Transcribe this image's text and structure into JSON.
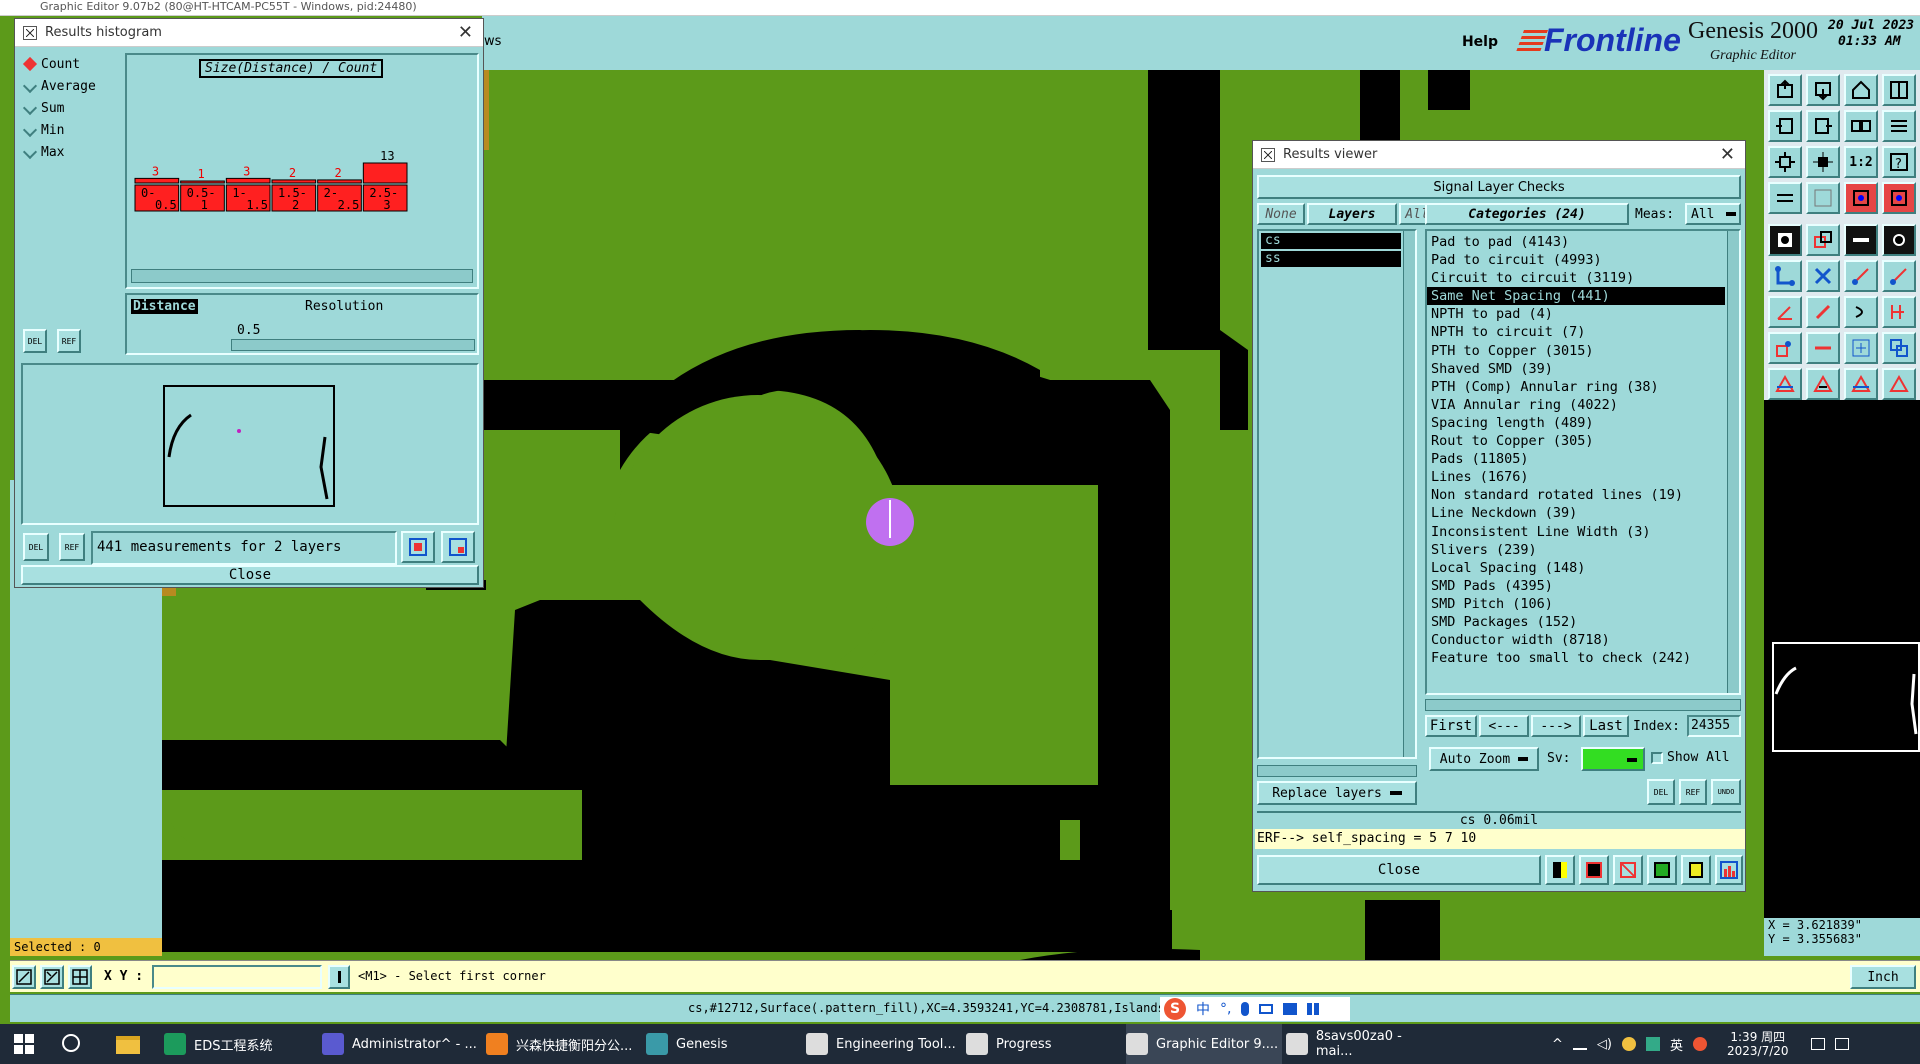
{
  "app": {
    "title": "Graphic Editor 9.07b2 (80@HT-HTCAM-PC55T - Windows, pid:24480)",
    "menu_help": "Help",
    "menu_partial": "ws",
    "logo_frontline": "Frontline",
    "logo_product": "Genesis 2000",
    "logo_subtitle": "Graphic Editor",
    "date": "20 Jul 2023",
    "time": "01:33 AM"
  },
  "histogram": {
    "window_title": "Results histogram",
    "options": [
      "Count",
      "Average",
      "Sum",
      "Min",
      "Max"
    ],
    "selected_option": "Count",
    "chart_title": "Size(Distance) / Count",
    "distance_label": "Distance",
    "resolution_label": "Resolution",
    "resolution_value": "0.5",
    "measurements_text": "441 measurements for 2 layers",
    "close_label": "Close",
    "del_label": "DEL",
    "ref_label": "REF"
  },
  "chart_data": {
    "type": "bar",
    "categories": [
      "0-0.5",
      "0.5-1",
      "1-1.5",
      "1.5-2",
      "2-2.5",
      "2.5-3"
    ],
    "category_labels": [
      [
        "0-",
        "0.5"
      ],
      [
        "0.5-",
        "1"
      ],
      [
        "1-",
        "1.5"
      ],
      [
        "1.5-",
        "2"
      ],
      [
        "2-",
        "2.5"
      ],
      [
        "2.5-",
        "3"
      ]
    ],
    "values": [
      3,
      1,
      3,
      2,
      2,
      13
    ],
    "title": "Size(Distance) / Count",
    "xlabel": "Distance",
    "ylabel": "",
    "ylim": [
      0,
      13
    ],
    "bar_color": "#ff2020",
    "grid": false
  },
  "results_viewer": {
    "window_title": "Results viewer",
    "header": "Signal Layer Checks",
    "none_label": "None",
    "layers_label": "Layers",
    "all_label": "All",
    "layers": [
      "cs",
      "ss"
    ],
    "categories_label": "Categories (24)",
    "meas_label": "Meas:",
    "meas_value": "All",
    "categories": [
      "Pad to pad (4143)",
      "Pad to circuit (4993)",
      "Circuit to circuit (3119)",
      "Same Net Spacing (441)",
      "NPTH to pad (4)",
      "NPTH to circuit (7)",
      "PTH to Copper (3015)",
      "Shaved SMD (39)",
      "PTH (Comp) Annular ring (38)",
      "VIA Annular ring (4022)",
      "Spacing length (489)",
      "Rout to Copper (305)",
      "Pads (11805)",
      "Lines (1676)",
      "Non standard rotated lines (19)",
      "Line Neckdown (39)",
      "Inconsistent Line Width (3)",
      "Slivers (239)",
      "Local Spacing (148)",
      "SMD Pads (4395)",
      "SMD Pitch (106)",
      "SMD Packages (152)",
      "Conductor width (8718)",
      "Feature too small to check (242)"
    ],
    "selected_category": "Same Net Spacing (441)",
    "first_label": "First",
    "prev_label": "<---",
    "next_label": "--->",
    "last_label": "Last",
    "index_label": "Index:",
    "index_value": "24355",
    "auto_zoom_label": "Auto Zoom",
    "sv_label": "Sv:",
    "show_all_label": "Show All",
    "replace_layers_label": "Replace layers",
    "status_value": "cs 0.06mil",
    "erf_text": "ERF--> self_spacing = 5 7 10",
    "close_label": "Close",
    "del_label": "DEL",
    "ref_label": "REF",
    "undo_label": "UNDO"
  },
  "status": {
    "selected": "Selected : 0",
    "xy_label": "X Y :",
    "prompt": "<M1> - Select first corner",
    "units": "Inch",
    "info_line": "cs,#12712,Surface(.pattern_fill),XC=4.3593241,YC=4.2308781,Islands=",
    "coord_x": "X = 3.621839\"",
    "coord_y": "Y = 3.355683\""
  },
  "taskbar": {
    "items": [
      "EDS工程系统",
      "Administrator^ - ...",
      "兴森快捷衡阳分公...",
      "Genesis",
      "Engineering Tool...",
      "Progress",
      "Graphic Editor 9....",
      "8savs00za0 - mai..."
    ],
    "tray_lang": "英",
    "ime_label": "中",
    "clock_time": "1:39 周四",
    "clock_date": "2023/7/20"
  },
  "colors": {
    "board_green": "#5c9a1a",
    "panel_teal": "#9ed9d9",
    "copper_black": "#000000",
    "marker_violet": "#c070f0",
    "highlight_yellow": "#ffffcc"
  }
}
